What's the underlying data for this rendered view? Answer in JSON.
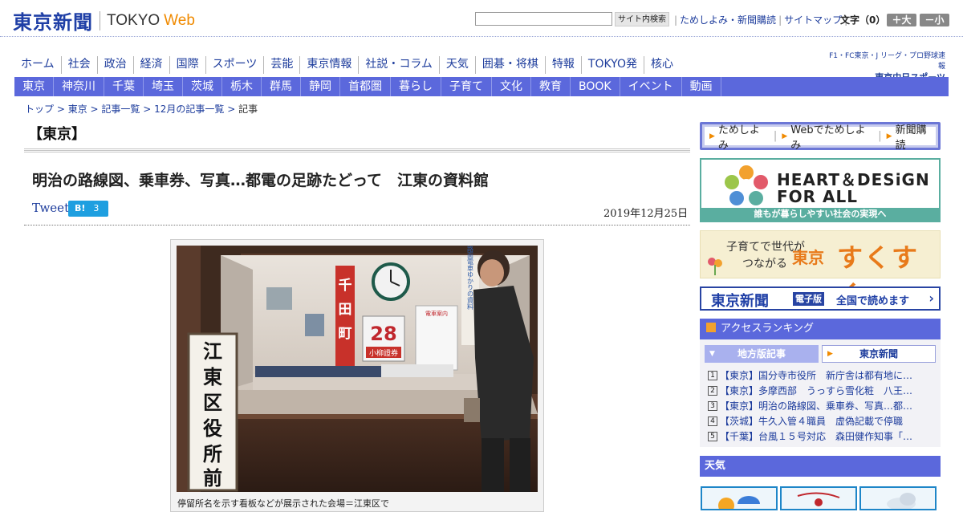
{
  "header": {
    "logo_jp": "東京新聞",
    "logo_tokyo": "TOKYO",
    "logo_web": "Web",
    "search_placeholder": "",
    "search_button": "サイト内検索",
    "links": [
      "ためしよみ・新聞購読",
      "サイトマップ"
    ],
    "font_size_label": "文字（0）",
    "font_up": "＋大",
    "font_down": "－小"
  },
  "nav1": [
    "ホーム",
    "社会",
    "政治",
    "経済",
    "国際",
    "スポーツ",
    "芸能",
    "東京情報",
    "社説・コラム",
    "天気",
    "囲碁・将棋",
    "特報",
    "TOKYO発",
    "核心"
  ],
  "chunichi": {
    "line1": "F1・FC東京・J リーグ・プロ野球速報",
    "line2": "東京中日スポーツ"
  },
  "nav2": [
    "東京",
    "神奈川",
    "千葉",
    "埼玉",
    "茨城",
    "栃木",
    "群馬",
    "静岡",
    "首都圏",
    "暮らし",
    "子育て",
    "文化",
    "教育",
    "BOOK",
    "イベント",
    "動画"
  ],
  "breadcrumb": [
    "トップ",
    "東京",
    "記事一覧",
    "12月の記事一覧"
  ],
  "breadcrumb_last": "記事",
  "region": "【東京】",
  "article": {
    "title": "明治の路線図、乗車券、写真…都電の足跡たどって　江東の資料館",
    "tweet": "Tweet",
    "hatena_label": "B!",
    "hatena_count": "3",
    "date": "2019年12月25日",
    "caption": "停留所名を示す看板などが展示された会場＝江東区で"
  },
  "photo_signs": {
    "stop_sign": "江東区役所前",
    "red_sign": "千田町",
    "number_sign": "28",
    "ticket_label": "小柳證券",
    "display_title": "路面電車ゆかりの資料",
    "board_label": "電車案内"
  },
  "sidebar": {
    "links": [
      "ためしよみ",
      "Webでためしよみ",
      "新聞購読"
    ],
    "heart_line1": "HEART＆DESiGN",
    "heart_line2": "FOR ALL",
    "heart_bar": "誰もが暮らしやすい社会の実現へ",
    "sukusuku_line1": "子育てで世代が",
    "sukusuku_line2": "つながる",
    "sukusuku_tokyo": "東京",
    "sukusuku_main": "すくすく",
    "digital_logo": "東京新聞",
    "digital_badge": "電子版",
    "digital_text": "全国で読めます",
    "ranking_title": "アクセスランキング",
    "ranking_tabs": [
      "地方版記事",
      "東京新聞"
    ],
    "ranking": [
      "【東京】国分寺市役所　新庁舎は都有地に…",
      "【東京】多摩西部　うっすら雪化粧　八王…",
      "【東京】明治の路線図、乗車券、写真…都…",
      "【茨城】牛久入管４職員　虚偽記載で停職",
      "【千葉】台風１５号対応　森田健作知事「…"
    ],
    "weather_title": "天気"
  },
  "colors": {
    "brand_blue": "#1f3fa6",
    "nav_blue": "#5b68dc",
    "accent_orange": "#f08a00",
    "teal": "#5aaea0"
  }
}
